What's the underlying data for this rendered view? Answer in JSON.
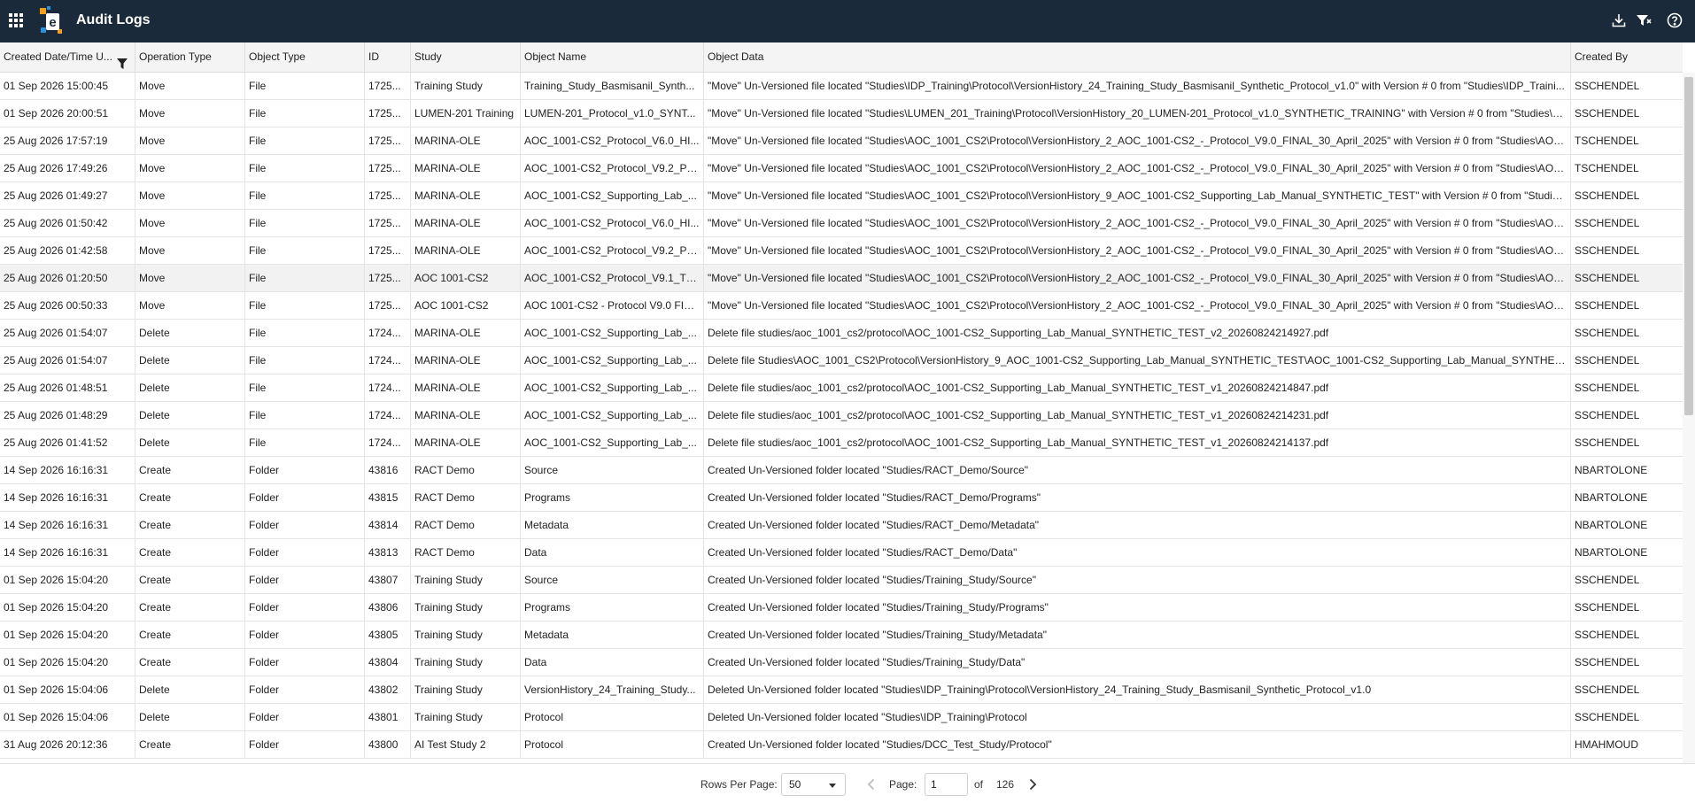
{
  "app": {
    "title": "Audit Logs",
    "logo_icon": "e-logo-icon",
    "colors": {
      "topbar": "#1b2a3a",
      "logo_orange": "#f5a01a",
      "logo_blue": "#2f8fd8"
    }
  },
  "toolbar": {
    "apps_icon": "grid-apps-icon",
    "export_icon": "download-icon",
    "filter_icon": "filter-icon",
    "help_icon": "help-icon"
  },
  "table": {
    "columns": [
      {
        "key": "created",
        "label": "Created Date/Time U..."
      },
      {
        "key": "operation",
        "label": "Operation Type"
      },
      {
        "key": "object_type",
        "label": "Object Type"
      },
      {
        "key": "id",
        "label": "ID"
      },
      {
        "key": "study",
        "label": "Study"
      },
      {
        "key": "object_name",
        "label": "Object Name"
      },
      {
        "key": "object_data",
        "label": "Object Data"
      },
      {
        "key": "created_by",
        "label": "Created By"
      }
    ],
    "rows": [
      {
        "created": "01 Sep 2026 15:00:45",
        "operation": "Move",
        "object_type": "File",
        "id": "1725...",
        "study": "Training Study",
        "object_name": "Training_Study_Basmisanil_Synth...",
        "object_data": "\"Move\" Un-Versioned file located \"Studies\\IDP_Training\\Protocol\\VersionHistory_24_Training_Study_Basmisanil_Synthetic_Protocol_v1.0\" with Version # 0 from \"Studies\\IDP_Traini...",
        "created_by": "SSCHENDEL"
      },
      {
        "created": "01 Sep 2026 20:00:51",
        "operation": "Move",
        "object_type": "File",
        "id": "1725...",
        "study": "LUMEN-201 Training",
        "object_name": "LUMEN-201_Protocol_v1.0_SYNT...",
        "object_data": "\"Move\" Un-Versioned file located \"Studies\\LUMEN_201_Training\\Protocol\\VersionHistory_20_LUMEN-201_Protocol_v1.0_SYNTHETIC_TRAINING\" with Version # 0 from \"Studies\\LU...",
        "created_by": "SSCHENDEL"
      },
      {
        "created": "25 Aug 2026 17:57:19",
        "operation": "Move",
        "object_type": "File",
        "id": "1725...",
        "study": "MARINA-OLE",
        "object_name": "AOC_1001-CS2_Protocol_V6.0_HI...",
        "object_data": "\"Move\" Un-Versioned file located \"Studies\\AOC_1001_CS2\\Protocol\\VersionHistory_2_AOC_1001-CS2_-_Protocol_V9.0_FINAL_30_April_2025\" with Version # 0 from \"Studies\\AOC_...",
        "created_by": "TSCHENDEL"
      },
      {
        "created": "25 Aug 2026 17:49:26",
        "operation": "Move",
        "object_type": "File",
        "id": "1725...",
        "study": "MARINA-OLE",
        "object_name": "AOC_1001-CS2_Protocol_V9.2_PH...",
        "object_data": "\"Move\" Un-Versioned file located \"Studies\\AOC_1001_CS2\\Protocol\\VersionHistory_2_AOC_1001-CS2_-_Protocol_V9.0_FINAL_30_April_2025\" with Version # 0 from \"Studies\\AOC_...",
        "created_by": "TSCHENDEL"
      },
      {
        "created": "25 Aug 2026 01:49:27",
        "operation": "Move",
        "object_type": "File",
        "id": "1725...",
        "study": "MARINA-OLE",
        "object_name": "AOC_1001-CS2_Supporting_Lab_...",
        "object_data": "\"Move\" Un-Versioned file located \"Studies\\AOC_1001_CS2\\Protocol\\VersionHistory_9_AOC_1001-CS2_Supporting_Lab_Manual_SYNTHETIC_TEST\" with Version # 0 from \"Studies\\...",
        "created_by": "SSCHENDEL"
      },
      {
        "created": "25 Aug 2026 01:50:42",
        "operation": "Move",
        "object_type": "File",
        "id": "1725...",
        "study": "MARINA-OLE",
        "object_name": "AOC_1001-CS2_Protocol_V6.0_HI...",
        "object_data": "\"Move\" Un-Versioned file located \"Studies\\AOC_1001_CS2\\Protocol\\VersionHistory_2_AOC_1001-CS2_-_Protocol_V9.0_FINAL_30_April_2025\" with Version # 0 from \"Studies\\AOC_...",
        "created_by": "SSCHENDEL"
      },
      {
        "created": "25 Aug 2026 01:42:58",
        "operation": "Move",
        "object_type": "File",
        "id": "1725...",
        "study": "MARINA-OLE",
        "object_name": "AOC_1001-CS2_Protocol_V9.2_PH...",
        "object_data": "\"Move\" Un-Versioned file located \"Studies\\AOC_1001_CS2\\Protocol\\VersionHistory_2_AOC_1001-CS2_-_Protocol_V9.0_FINAL_30_April_2025\" with Version # 0 from \"Studies\\AOC_...",
        "created_by": "SSCHENDEL"
      },
      {
        "created": "25 Aug 2026 01:20:50",
        "operation": "Move",
        "object_type": "File",
        "id": "1725...",
        "study": "AOC 1001-CS2",
        "object_name": "AOC_1001-CS2_Protocol_V9.1_TR...",
        "object_data": "\"Move\" Un-Versioned file located \"Studies\\AOC_1001_CS2\\Protocol\\VersionHistory_2_AOC_1001-CS2_-_Protocol_V9.0_FINAL_30_April_2025\" with Version # 0 from \"Studies\\AOC_...",
        "created_by": "SSCHENDEL"
      },
      {
        "created": "25 Aug 2026 00:50:33",
        "operation": "Move",
        "object_type": "File",
        "id": "1725...",
        "study": "AOC 1001-CS2",
        "object_name": "AOC 1001-CS2 - Protocol V9.0 FIN...",
        "object_data": "\"Move\" Un-Versioned file located \"Studies\\AOC_1001_CS2\\Protocol\\VersionHistory_2_AOC_1001-CS2_-_Protocol_V9.0_FINAL_30_April_2025\" with Version # 0 from \"Studies\\AOC_...",
        "created_by": "SSCHENDEL"
      },
      {
        "created": "25 Aug 2026 01:54:07",
        "operation": "Delete",
        "object_type": "File",
        "id": "1724...",
        "study": "MARINA-OLE",
        "object_name": "AOC_1001-CS2_Supporting_Lab_...",
        "object_data": "Delete file studies/aoc_1001_cs2/protocol\\AOC_1001-CS2_Supporting_Lab_Manual_SYNTHETIC_TEST_v2_20260824214927.pdf",
        "created_by": "SSCHENDEL"
      },
      {
        "created": "25 Aug 2026 01:54:07",
        "operation": "Delete",
        "object_type": "File",
        "id": "1724...",
        "study": "MARINA-OLE",
        "object_name": "AOC_1001-CS2_Supporting_Lab_...",
        "object_data": "Delete file Studies\\AOC_1001_CS2\\Protocol\\VersionHistory_9_AOC_1001-CS2_Supporting_Lab_Manual_SYNTHETIC_TEST\\AOC_1001-CS2_Supporting_Lab_Manual_SYNTHETIC_T...",
        "created_by": "SSCHENDEL"
      },
      {
        "created": "25 Aug 2026 01:48:51",
        "operation": "Delete",
        "object_type": "File",
        "id": "1724...",
        "study": "MARINA-OLE",
        "object_name": "AOC_1001-CS2_Supporting_Lab_...",
        "object_data": "Delete file studies/aoc_1001_cs2/protocol\\AOC_1001-CS2_Supporting_Lab_Manual_SYNTHETIC_TEST_v1_20260824214847.pdf",
        "created_by": "SSCHENDEL"
      },
      {
        "created": "25 Aug 2026 01:48:29",
        "operation": "Delete",
        "object_type": "File",
        "id": "1724...",
        "study": "MARINA-OLE",
        "object_name": "AOC_1001-CS2_Supporting_Lab_...",
        "object_data": "Delete file studies/aoc_1001_cs2/protocol\\AOC_1001-CS2_Supporting_Lab_Manual_SYNTHETIC_TEST_v1_20260824214231.pdf",
        "created_by": "SSCHENDEL"
      },
      {
        "created": "25 Aug 2026 01:41:52",
        "operation": "Delete",
        "object_type": "File",
        "id": "1724...",
        "study": "MARINA-OLE",
        "object_name": "AOC_1001-CS2_Supporting_Lab_...",
        "object_data": "Delete file studies/aoc_1001_cs2/protocol\\AOC_1001-CS2_Supporting_Lab_Manual_SYNTHETIC_TEST_v1_20260824214137.pdf",
        "created_by": "SSCHENDEL"
      },
      {
        "created": "14 Sep 2026 16:16:31",
        "operation": "Create",
        "object_type": "Folder",
        "id": "43816",
        "study": "RACT Demo",
        "object_name": "Source",
        "object_data": "Created Un-Versioned folder located \"Studies/RACT_Demo/Source\"",
        "created_by": "NBARTOLONE"
      },
      {
        "created": "14 Sep 2026 16:16:31",
        "operation": "Create",
        "object_type": "Folder",
        "id": "43815",
        "study": "RACT Demo",
        "object_name": "Programs",
        "object_data": "Created Un-Versioned folder located \"Studies/RACT_Demo/Programs\"",
        "created_by": "NBARTOLONE"
      },
      {
        "created": "14 Sep 2026 16:16:31",
        "operation": "Create",
        "object_type": "Folder",
        "id": "43814",
        "study": "RACT Demo",
        "object_name": "Metadata",
        "object_data": "Created Un-Versioned folder located \"Studies/RACT_Demo/Metadata\"",
        "created_by": "NBARTOLONE"
      },
      {
        "created": "14 Sep 2026 16:16:31",
        "operation": "Create",
        "object_type": "Folder",
        "id": "43813",
        "study": "RACT Demo",
        "object_name": "Data",
        "object_data": "Created Un-Versioned folder located \"Studies/RACT_Demo/Data\"",
        "created_by": "NBARTOLONE"
      },
      {
        "created": "01 Sep 2026 15:04:20",
        "operation": "Create",
        "object_type": "Folder",
        "id": "43807",
        "study": "Training Study",
        "object_name": "Source",
        "object_data": "Created Un-Versioned folder located \"Studies/Training_Study/Source\"",
        "created_by": "SSCHENDEL"
      },
      {
        "created": "01 Sep 2026 15:04:20",
        "operation": "Create",
        "object_type": "Folder",
        "id": "43806",
        "study": "Training Study",
        "object_name": "Programs",
        "object_data": "Created Un-Versioned folder located \"Studies/Training_Study/Programs\"",
        "created_by": "SSCHENDEL"
      },
      {
        "created": "01 Sep 2026 15:04:20",
        "operation": "Create",
        "object_type": "Folder",
        "id": "43805",
        "study": "Training Study",
        "object_name": "Metadata",
        "object_data": "Created Un-Versioned folder located \"Studies/Training_Study/Metadata\"",
        "created_by": "SSCHENDEL"
      },
      {
        "created": "01 Sep 2026 15:04:20",
        "operation": "Create",
        "object_type": "Folder",
        "id": "43804",
        "study": "Training Study",
        "object_name": "Data",
        "object_data": "Created Un-Versioned folder located \"Studies/Training_Study/Data\"",
        "created_by": "SSCHENDEL"
      },
      {
        "created": "01 Sep 2026 15:04:06",
        "operation": "Delete",
        "object_type": "Folder",
        "id": "43802",
        "study": "Training Study",
        "object_name": "VersionHistory_24_Training_Study...",
        "object_data": "Deleted Un-Versioned folder located \"Studies\\IDP_Training\\Protocol\\VersionHistory_24_Training_Study_Basmisanil_Synthetic_Protocol_v1.0",
        "created_by": "SSCHENDEL"
      },
      {
        "created": "01 Sep 2026 15:04:06",
        "operation": "Delete",
        "object_type": "Folder",
        "id": "43801",
        "study": "Training Study",
        "object_name": "Protocol",
        "object_data": "Deleted Un-Versioned folder located \"Studies\\IDP_Training\\Protocol",
        "created_by": "SSCHENDEL"
      },
      {
        "created": "31 Aug 2026 20:12:36",
        "operation": "Create",
        "object_type": "Folder",
        "id": "43800",
        "study": "AI Test Study 2",
        "object_name": "Protocol",
        "object_data": "Created Un-Versioned folder located \"Studies/DCC_Test_Study/Protocol\"",
        "created_by": "HMAHMOUD"
      }
    ],
    "selected_row_index": 7
  },
  "pagination": {
    "rows_per_page_label": "Rows Per Page:",
    "rows_per_page_value": "50",
    "page_label": "Page:",
    "page_value": "1",
    "of_label": "of",
    "total_pages": "126",
    "prev_icon": "chevron-left-icon",
    "next_icon": "chevron-right-icon"
  }
}
